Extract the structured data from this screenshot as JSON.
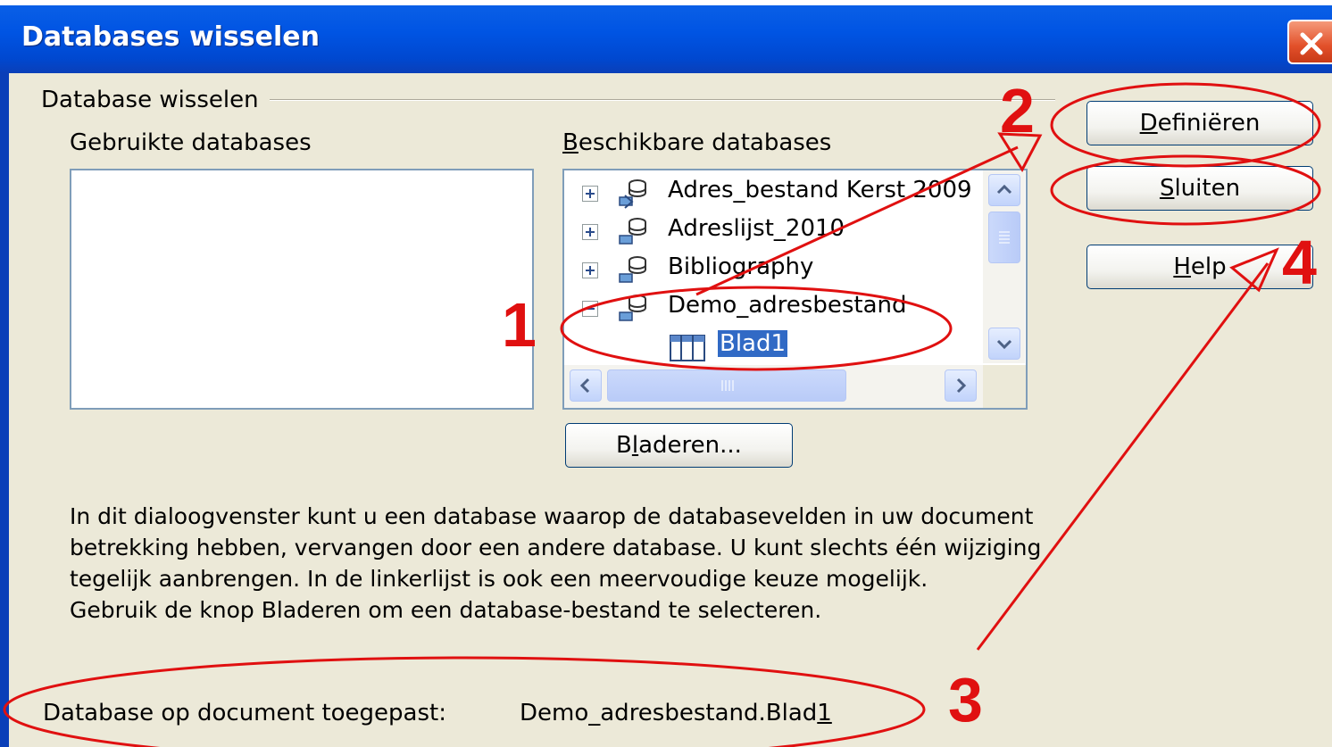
{
  "window": {
    "title": "Databases wisselen"
  },
  "group": {
    "label": "Database wisselen",
    "used_label": "Gebruikte databases",
    "available_label": "Beschikbare databases"
  },
  "tree": {
    "items": [
      {
        "label": "Adres_bestand Kerst 2009",
        "expanded": false
      },
      {
        "label": "Adreslijst_2010",
        "expanded": false
      },
      {
        "label": "Bibliography",
        "expanded": false
      },
      {
        "label": "Demo_adresbestand",
        "expanded": true
      },
      {
        "label": "Blad1",
        "selected": true
      }
    ]
  },
  "buttons": {
    "define": {
      "prefix": "",
      "hot": "D",
      "rest": "efiniëren"
    },
    "close": {
      "prefix": "",
      "hot": "S",
      "rest": "luiten"
    },
    "help": {
      "prefix": "",
      "hot": "H",
      "rest": "elp"
    },
    "browse": {
      "prefix": "B",
      "hot": "l",
      "rest": "aderen..."
    }
  },
  "description": [
    "In dit dialoogvenster kunt u een database waarop de databasevelden in uw document betrekking hebben, vervangen door een andere database. U kunt slechts één wijziging tegelijk aanbrengen. In de linkerlijst is ook een meervoudige keuze mogelijk.",
    "Gebruik de knop Bladeren om een database-bestand te selecteren."
  ],
  "applied": {
    "label": "Database op document toegepast:",
    "value_main": "Demo_adresbestand.Blad",
    "value_hot": "1"
  },
  "annotations": [
    "1",
    "2",
    "3",
    "4"
  ],
  "colors": {
    "annotation": "#e01010",
    "titlebar": "#0054e3",
    "selection": "#316ac5",
    "dialog_bg": "#ECE9D8"
  }
}
